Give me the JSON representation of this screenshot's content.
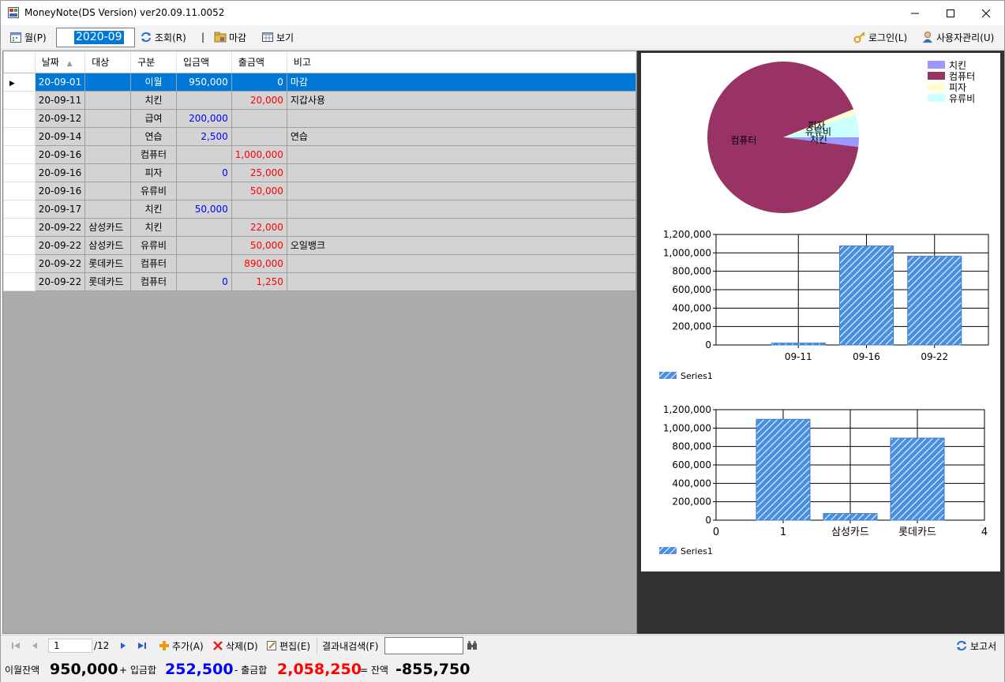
{
  "window": {
    "title": "MoneyNote(DS Version) ver20.09.11.0052"
  },
  "toolbar": {
    "month_button": "월(P)",
    "month_value": "2020-09",
    "query_button": "조회(R)",
    "separator": "|",
    "close_button": "마감",
    "view_button": "보기",
    "login_button": "로그인(L)",
    "user_admin_button": "사용자관리(U)"
  },
  "grid": {
    "columns": [
      "날짜",
      "대상",
      "구분",
      "입금액",
      "출금액",
      "비고"
    ],
    "rows": [
      {
        "date": "20-09-01",
        "target": "",
        "category": "이월",
        "deposit": "950,000",
        "withdraw": "0",
        "note": "마감"
      },
      {
        "date": "20-09-11",
        "target": "",
        "category": "치킨",
        "deposit": "",
        "withdraw": "20,000",
        "note": "지갑사용"
      },
      {
        "date": "20-09-12",
        "target": "",
        "category": "급여",
        "deposit": "200,000",
        "withdraw": "",
        "note": ""
      },
      {
        "date": "20-09-14",
        "target": "",
        "category": "연습",
        "deposit": "2,500",
        "withdraw": "",
        "note": "연습"
      },
      {
        "date": "20-09-16",
        "target": "",
        "category": "컴퓨터",
        "deposit": "",
        "withdraw": "1,000,000",
        "note": ""
      },
      {
        "date": "20-09-16",
        "target": "",
        "category": "피자",
        "deposit": "0",
        "withdraw": "25,000",
        "note": ""
      },
      {
        "date": "20-09-16",
        "target": "",
        "category": "유류비",
        "deposit": "",
        "withdraw": "50,000",
        "note": ""
      },
      {
        "date": "20-09-17",
        "target": "",
        "category": "치킨",
        "deposit": "50,000",
        "withdraw": "",
        "note": ""
      },
      {
        "date": "20-09-22",
        "target": "삼성카드",
        "category": "치킨",
        "deposit": "",
        "withdraw": "22,000",
        "note": ""
      },
      {
        "date": "20-09-22",
        "target": "삼성카드",
        "category": "유류비",
        "deposit": "",
        "withdraw": "50,000",
        "note": "오일뱅크"
      },
      {
        "date": "20-09-22",
        "target": "롯데카드",
        "category": "컴퓨터",
        "deposit": "",
        "withdraw": "890,000",
        "note": ""
      },
      {
        "date": "20-09-22",
        "target": "롯데카드",
        "category": "컴퓨터",
        "deposit": "0",
        "withdraw": "1,250",
        "note": ""
      }
    ]
  },
  "chart_data": [
    {
      "type": "pie",
      "categories": [
        "치킨",
        "컴퓨터",
        "피자",
        "유류비"
      ],
      "values": [
        42000,
        1891250,
        25000,
        100000
      ],
      "legend_position": "top-right",
      "slice_labels": [
        "치킨",
        "컴퓨터",
        "피자",
        "유류비"
      ],
      "colors": [
        "#9999ff",
        "#993366",
        "#ffffcc",
        "#ccffff"
      ]
    },
    {
      "type": "bar",
      "categories": [
        "09-11",
        "09-16",
        "09-22"
      ],
      "series": [
        {
          "name": "Series1",
          "values": [
            20000,
            1075000,
            963250
          ]
        }
      ],
      "ylim": [
        0,
        1200000
      ],
      "yticks": [
        "0",
        "200,000",
        "400,000",
        "600,000",
        "800,000",
        "1,000,000",
        "1,200,000"
      ],
      "grid": true,
      "legend_position": "bottom-left",
      "color": "#4a90e2"
    },
    {
      "type": "bar",
      "categories": [
        "1",
        "삼성카드",
        "롯데카드"
      ],
      "x_ticks": [
        "0",
        "1",
        "삼성카드",
        "롯데카드",
        "4"
      ],
      "series": [
        {
          "name": "Series1",
          "values": [
            1095000,
            72000,
            891250
          ]
        }
      ],
      "ylim": [
        0,
        1200000
      ],
      "yticks": [
        "0",
        "200,000",
        "400,000",
        "600,000",
        "800,000",
        "1,000,000",
        "1,200,000"
      ],
      "grid": true,
      "legend_position": "bottom-left",
      "color": "#4a90e2"
    }
  ],
  "navigator": {
    "position": "1",
    "total": "/12",
    "add_button": "추가(A)",
    "delete_button": "삭제(D)",
    "edit_button": "편집(E)",
    "search_label": "결과내검색(F)",
    "search_value": "",
    "report_button": "보고서"
  },
  "summary": {
    "carry_label": "이월잔액",
    "carry_value": "950,000",
    "deposit_label": "+ 입금합",
    "deposit_value": "252,500",
    "withdraw_label": "- 출금합",
    "withdraw_value": "2,058,250",
    "balance_label": "= 잔액",
    "balance_value": "-855,750"
  }
}
